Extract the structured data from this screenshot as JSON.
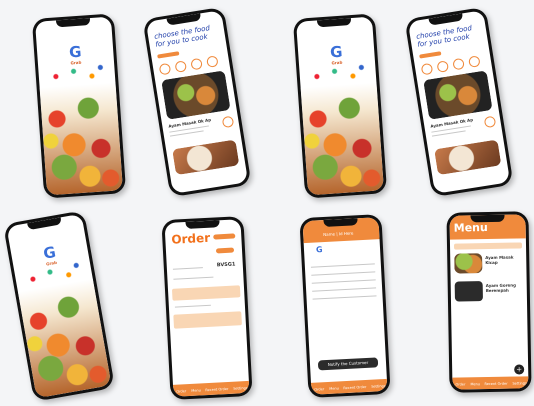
{
  "screens": {
    "splash": {
      "logo_text": "Grab"
    },
    "choose": {
      "heading": "choose the food for you to cook",
      "dish1": "Ayam Masak Ok Ap",
      "tag": "Ayam"
    },
    "order": {
      "title": "Order",
      "vehicle": "BVSG1",
      "tabs": [
        "Order",
        "Menu",
        "Recent Order",
        "Settings"
      ]
    },
    "receipt": {
      "header": "Name | Id Here",
      "button": "Notify the Customer",
      "tabs": [
        "Order",
        "Menu",
        "Recent Order",
        "Settings"
      ]
    },
    "menu": {
      "title": "Menu",
      "item1": "Ayam Masak Kicap",
      "item2": "Ayam Goreng Berempah",
      "tabs": [
        "Order",
        "Menu",
        "Recent Order",
        "Settings"
      ]
    }
  },
  "colors": {
    "accent": "#f08a3c",
    "title": "#f2711c",
    "brand": "#3a6fd8"
  }
}
